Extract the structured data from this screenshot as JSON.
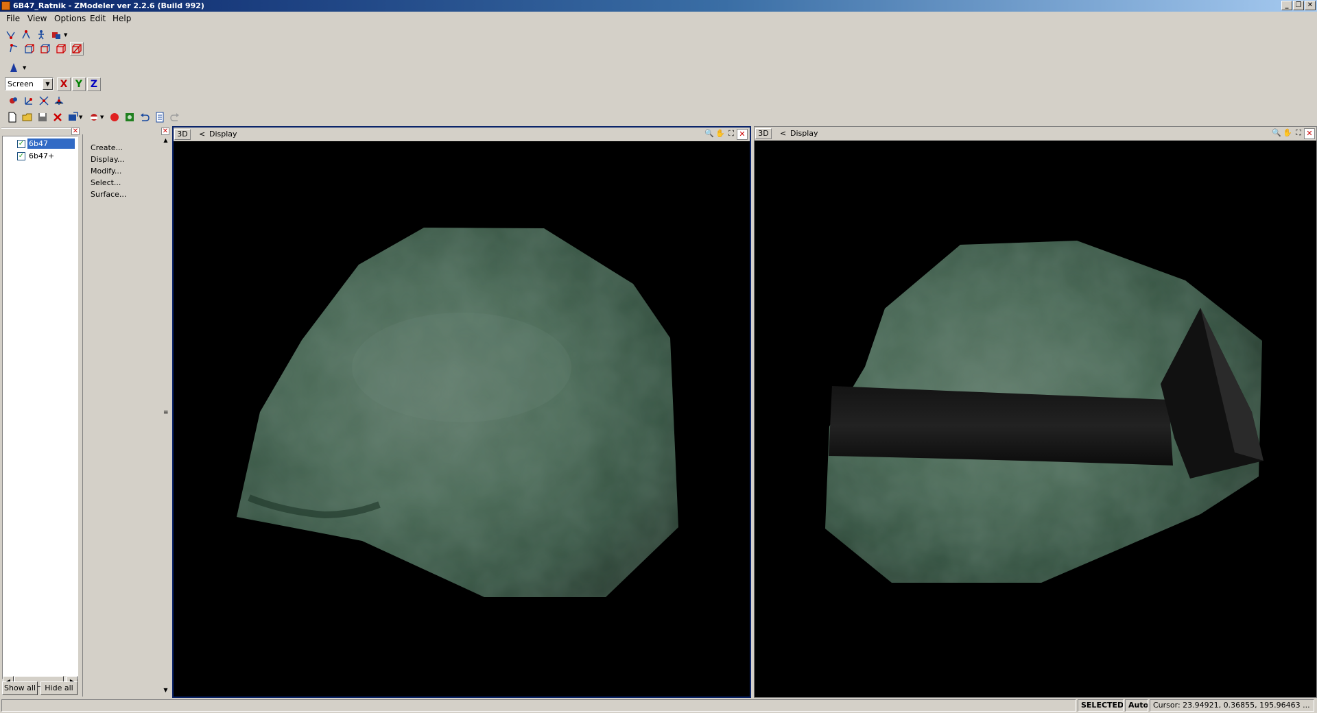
{
  "window": {
    "title": "6B47_Ratnik - ZModeler ver 2.2.6 (Build 992)",
    "controls": {
      "minimize": "_",
      "restore": "❐",
      "close": "✕"
    }
  },
  "menu": [
    "File",
    "View",
    "Options",
    "Edit",
    "Help"
  ],
  "toolbar": {
    "view_mode": "Screen",
    "axes": {
      "x": "X",
      "y": "Y",
      "z": "Z"
    },
    "axis_colors": {
      "x": "#c00000",
      "y": "#008000",
      "z": "#0000c0"
    }
  },
  "objects_panel": {
    "items": [
      {
        "label": "6b47",
        "checked": true,
        "selected": true
      },
      {
        "label": "6b47+",
        "checked": true,
        "selected": false
      }
    ],
    "show_all": "Show all",
    "hide_all": "Hide all"
  },
  "command_panel": {
    "items": [
      "Create...",
      "Display...",
      "Modify...",
      "Select...",
      "Surface..."
    ]
  },
  "viewports": [
    {
      "mode": "3D",
      "label": "Display",
      "active": true
    },
    {
      "mode": "3D",
      "label": "Display",
      "active": false
    }
  ],
  "status": {
    "mode": "SELECTED MODE",
    "snap": "Auto",
    "cursor": "Cursor: 23.94921, 0.36855, 195.96463 ..."
  }
}
